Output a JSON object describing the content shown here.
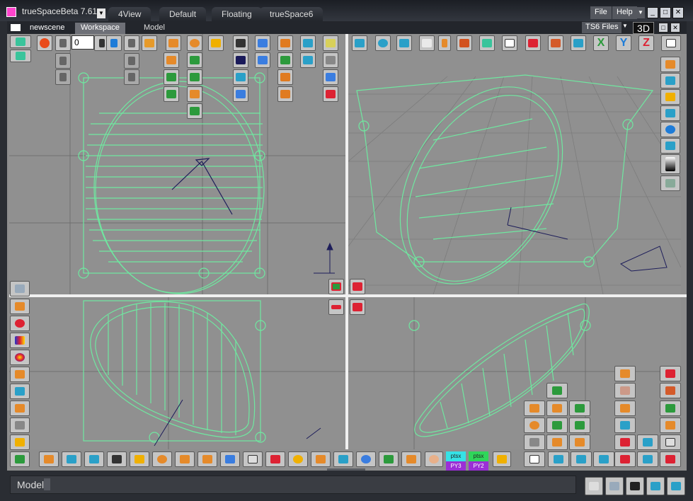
{
  "titlebar": {
    "app_title": "trueSpaceBeta 7.61",
    "layouts": [
      "4View",
      "Default",
      "Floating",
      "trueSpace6"
    ],
    "menus": [
      "File",
      "Help"
    ]
  },
  "panels": {
    "scene_tab": "newscene",
    "tabs": [
      "Workspace",
      "Model"
    ],
    "ts6_files": "TS6 Files",
    "view_mode": "3D"
  },
  "toolbar": {
    "frame_value": "0"
  },
  "render_panels": [
    {
      "top": "ptsx",
      "bottom": "PY3"
    },
    {
      "top": "ptsx",
      "bottom": "PY2"
    }
  ],
  "statusbar": {
    "text": "Model"
  },
  "colors": {
    "wireframe": "#6fe8a0",
    "viewport_bg": "#909090",
    "grid": "#6f6f6f",
    "chrome": "#2a2d33"
  }
}
